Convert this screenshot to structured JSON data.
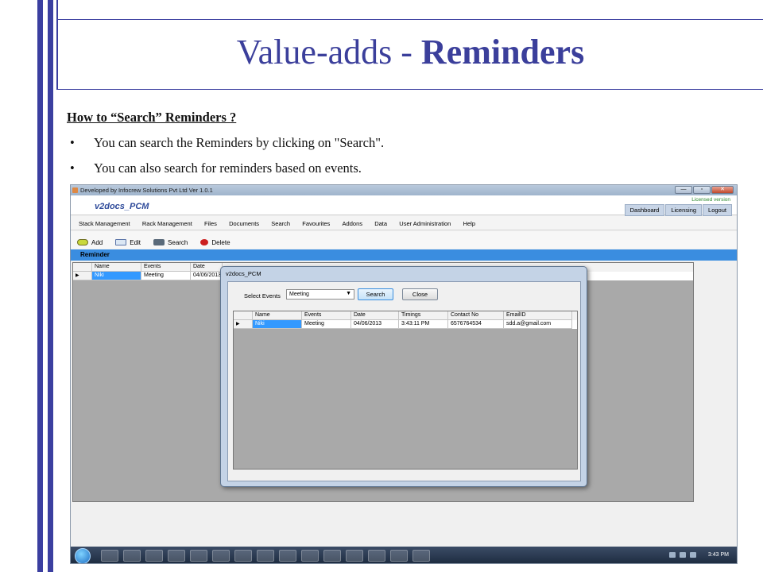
{
  "slide": {
    "title_prefix": "Value-adds  -",
    "title_main": "Reminders",
    "heading": "How to “Search” Reminders ?",
    "bullets": [
      "You can search the Reminders by clicking on \"Search\".",
      "You can also search for reminders based on events."
    ],
    "bullet_symbol": "•"
  },
  "app": {
    "window_title": "Developed by Infocrew Solutions Pvt Ltd Ver 1.0.1",
    "logo": "v2docs_PCM",
    "license_text": "Licensed version",
    "top_nav": [
      "Dashboard",
      "Licensing",
      "Logout"
    ],
    "window_buttons": [
      "—",
      "▫",
      "✕"
    ],
    "menu": [
      "Stack Management",
      "Rack Management",
      "Files",
      "Documents",
      "Search",
      "Favourites",
      "Addons",
      "Data",
      "User Administration",
      "Help"
    ],
    "toolbar": [
      {
        "label": "Add",
        "icon": "add-icon"
      },
      {
        "label": "Edit",
        "icon": "edit-icon"
      },
      {
        "label": "Search",
        "icon": "search-icon"
      },
      {
        "label": "Delete",
        "icon": "delete-icon"
      }
    ],
    "section_title": "Reminder",
    "grid": {
      "columns": [
        "Name",
        "Events",
        "Date"
      ],
      "rows": [
        [
          "Niki",
          "Meeting",
          "04/06/2013"
        ]
      ]
    }
  },
  "dialog": {
    "title": "v2docs_PCM",
    "select_label": "Select Events",
    "select_value": "Meeting",
    "search_button": "Search",
    "close_button": "Close",
    "grid": {
      "columns": [
        "Name",
        "Events",
        "Date",
        "Timings",
        "Contact No",
        "EmailID"
      ],
      "rows": [
        [
          "Niki",
          "Meeting",
          "04/06/2013",
          "3:43:11 PM",
          "6576764534",
          "sdd.a@gmail.com"
        ]
      ]
    }
  },
  "taskbar": {
    "clock": "3:43 PM",
    "colors": {
      "accent": "#3b3fa0",
      "selection": "#3399ff",
      "section": "#3a8de0"
    }
  }
}
